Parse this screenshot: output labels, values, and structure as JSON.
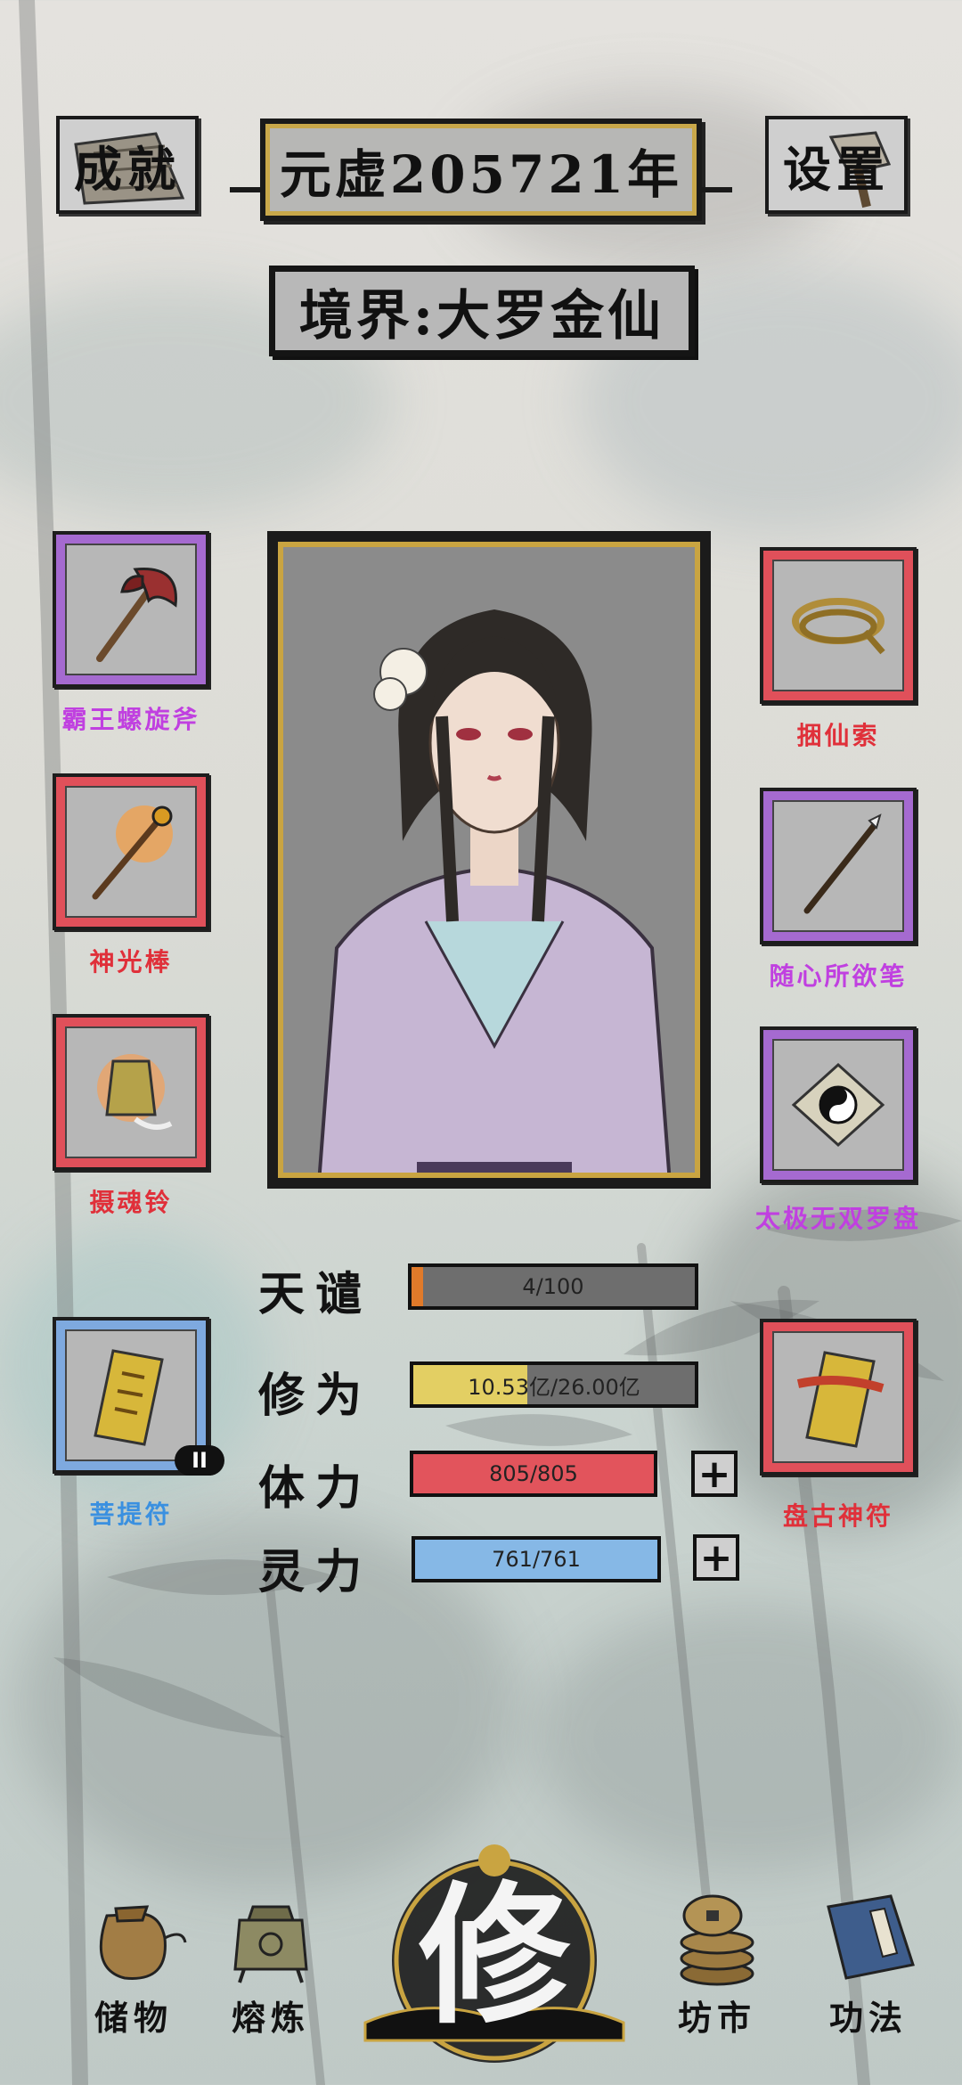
{
  "header": {
    "achievements_label": "成就",
    "year_label": "元虚205721年",
    "settings_label": "设置"
  },
  "realm_label": "境界:大罗金仙",
  "equipment": {
    "left": [
      {
        "name": "霸王螺旋斧",
        "rarity_color": "#c040e0"
      },
      {
        "name": "神光棒",
        "rarity_color": "#e0303a"
      },
      {
        "name": "摄魂铃",
        "rarity_color": "#e0303a"
      },
      {
        "name": "菩提符",
        "rarity_color": "#3a90e0",
        "badge": "II"
      }
    ],
    "right": [
      {
        "name": "捆仙索",
        "rarity_color": "#e0303a"
      },
      {
        "name": "随心所欲笔",
        "rarity_color": "#c040e0"
      },
      {
        "name": "太极无双罗盘",
        "rarity_color": "#c040e0"
      },
      {
        "name": "盘古神符",
        "rarity_color": "#e0303a"
      }
    ]
  },
  "stats": {
    "tianqian": {
      "label": "天谴",
      "value": "4/100",
      "fraction": 0.04,
      "color": "#e07a2a"
    },
    "xiuwei": {
      "label": "修为",
      "value": "10.53亿/26.00亿",
      "fraction": 0.405,
      "color": "#e3cf63"
    },
    "tili": {
      "label": "体力",
      "value": "805/805",
      "fraction": 1.0,
      "color": "#e2545c"
    },
    "lingli": {
      "label": "灵力",
      "value": "761/761",
      "fraction": 1.0,
      "color": "#86b8e6"
    },
    "plus_symbol": "+"
  },
  "nav": {
    "storage": "储物",
    "smelt": "熔炼",
    "cultivate": "修",
    "market": "坊市",
    "skills": "功法"
  }
}
